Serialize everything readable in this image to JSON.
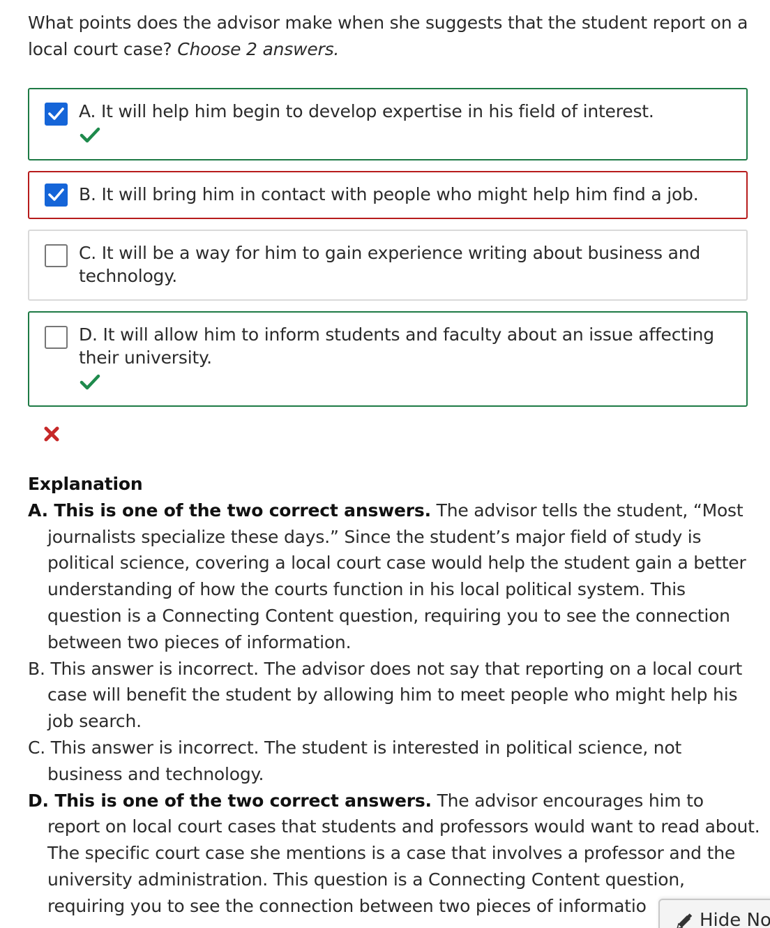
{
  "question": {
    "text": "What points does the advisor make when she suggests that the student report on a local court case? ",
    "instruction": "Choose 2 answers."
  },
  "options": [
    {
      "label": "A. It will help him begin to develop expertise in his field of interest.",
      "checked": true,
      "status": "correct",
      "correct_mark": true
    },
    {
      "label": "B. It will bring him in contact with people who might help him find a job.",
      "checked": true,
      "status": "incorrect",
      "correct_mark": false
    },
    {
      "label": "C. It will be a way for him to gain experience writing about business and technology.",
      "checked": false,
      "status": "neutral",
      "correct_mark": false
    },
    {
      "label": "D. It will allow him to inform students and faculty about an issue affecting their university.",
      "checked": false,
      "status": "correct",
      "correct_mark": true
    }
  ],
  "result_icon": "x-icon",
  "explanation": {
    "title": "Explanation",
    "items": [
      {
        "bold": "A. This is one of the two correct answers.",
        "text": " The advisor tells the student, “Most journalists specialize these days.” Since the student’s major field of study is political science, covering a local court case would help the student gain a better understanding of how the courts function in his local political system. This question is a Connecting Content question, requiring you to see the connection between two pieces of information."
      },
      {
        "bold": "",
        "text": "B. This answer is incorrect. The advisor does not say that reporting on a local court case will benefit the student by allowing him to meet people who might help his job search."
      },
      {
        "bold": "",
        "text": "C. This answer is incorrect. The student is interested in political science, not business and technology."
      },
      {
        "bold": "D. This is one of the two correct answers.",
        "text": " The advisor encourages him to report on local court cases that students and professors would want to read about. The specific court case she mentions is a case that involves a professor and the university administration. This question is a Connecting Content question, requiring you to see the connection between two pieces of informatio"
      }
    ]
  },
  "hide_notes": {
    "label": "Hide No",
    "icon": "pencil-icon"
  },
  "colors": {
    "correct": "#1e7a45",
    "incorrect": "#b71c1c",
    "checkbox": "#1565d8",
    "checkmark": "#1e8a4c",
    "xmark": "#c62828"
  }
}
